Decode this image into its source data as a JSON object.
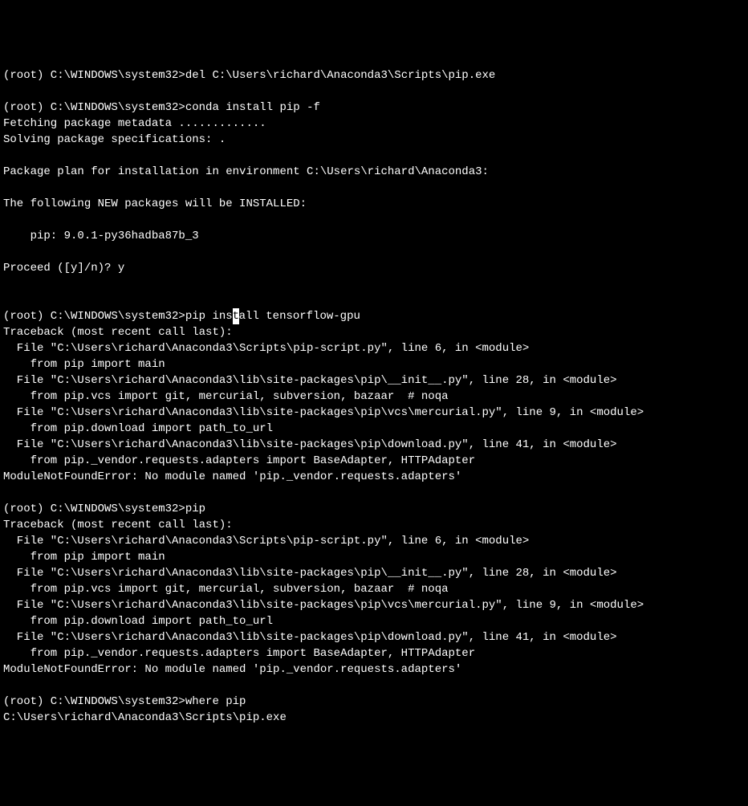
{
  "terminal": {
    "lines": [
      {
        "prompt": "(root) C:\\WINDOWS\\system32>",
        "cmd": "del C:\\Users\\richard\\Anaconda3\\Scripts\\pip.exe"
      },
      {
        "blank": true
      },
      {
        "prompt": "(root) C:\\WINDOWS\\system32>",
        "cmd": "conda install pip -f"
      },
      {
        "output": "Fetching package metadata ............."
      },
      {
        "output": "Solving package specifications: ."
      },
      {
        "blank": true
      },
      {
        "output": "Package plan for installation in environment C:\\Users\\richard\\Anaconda3:"
      },
      {
        "blank": true
      },
      {
        "output": "The following NEW packages will be INSTALLED:"
      },
      {
        "blank": true
      },
      {
        "output": "    pip: 9.0.1-py36hadba87b_3"
      },
      {
        "blank": true
      },
      {
        "output": "Proceed ([y]/n)? y"
      },
      {
        "blank": true
      },
      {
        "blank": true
      },
      {
        "prompt": "(root) C:\\WINDOWS\\system32>",
        "cmd_before": "pip ins",
        "cursor_char": "t",
        "cmd_after": "all tensorflow-gpu"
      },
      {
        "output": "Traceback (most recent call last):"
      },
      {
        "output": "  File \"C:\\Users\\richard\\Anaconda3\\Scripts\\pip-script.py\", line 6, in <module>"
      },
      {
        "output": "    from pip import main"
      },
      {
        "output": "  File \"C:\\Users\\richard\\Anaconda3\\lib\\site-packages\\pip\\__init__.py\", line 28, in <module>"
      },
      {
        "output": "    from pip.vcs import git, mercurial, subversion, bazaar  # noqa"
      },
      {
        "output": "  File \"C:\\Users\\richard\\Anaconda3\\lib\\site-packages\\pip\\vcs\\mercurial.py\", line 9, in <module>"
      },
      {
        "output": "    from pip.download import path_to_url"
      },
      {
        "output": "  File \"C:\\Users\\richard\\Anaconda3\\lib\\site-packages\\pip\\download.py\", line 41, in <module>"
      },
      {
        "output": "    from pip._vendor.requests.adapters import BaseAdapter, HTTPAdapter"
      },
      {
        "output": "ModuleNotFoundError: No module named 'pip._vendor.requests.adapters'"
      },
      {
        "blank": true
      },
      {
        "prompt": "(root) C:\\WINDOWS\\system32>",
        "cmd": "pip"
      },
      {
        "output": "Traceback (most recent call last):"
      },
      {
        "output": "  File \"C:\\Users\\richard\\Anaconda3\\Scripts\\pip-script.py\", line 6, in <module>"
      },
      {
        "output": "    from pip import main"
      },
      {
        "output": "  File \"C:\\Users\\richard\\Anaconda3\\lib\\site-packages\\pip\\__init__.py\", line 28, in <module>"
      },
      {
        "output": "    from pip.vcs import git, mercurial, subversion, bazaar  # noqa"
      },
      {
        "output": "  File \"C:\\Users\\richard\\Anaconda3\\lib\\site-packages\\pip\\vcs\\mercurial.py\", line 9, in <module>"
      },
      {
        "output": "    from pip.download import path_to_url"
      },
      {
        "output": "  File \"C:\\Users\\richard\\Anaconda3\\lib\\site-packages\\pip\\download.py\", line 41, in <module>"
      },
      {
        "output": "    from pip._vendor.requests.adapters import BaseAdapter, HTTPAdapter"
      },
      {
        "output": "ModuleNotFoundError: No module named 'pip._vendor.requests.adapters'"
      },
      {
        "blank": true
      },
      {
        "prompt": "(root) C:\\WINDOWS\\system32>",
        "cmd": "where pip"
      },
      {
        "output": "C:\\Users\\richard\\Anaconda3\\Scripts\\pip.exe"
      }
    ]
  }
}
